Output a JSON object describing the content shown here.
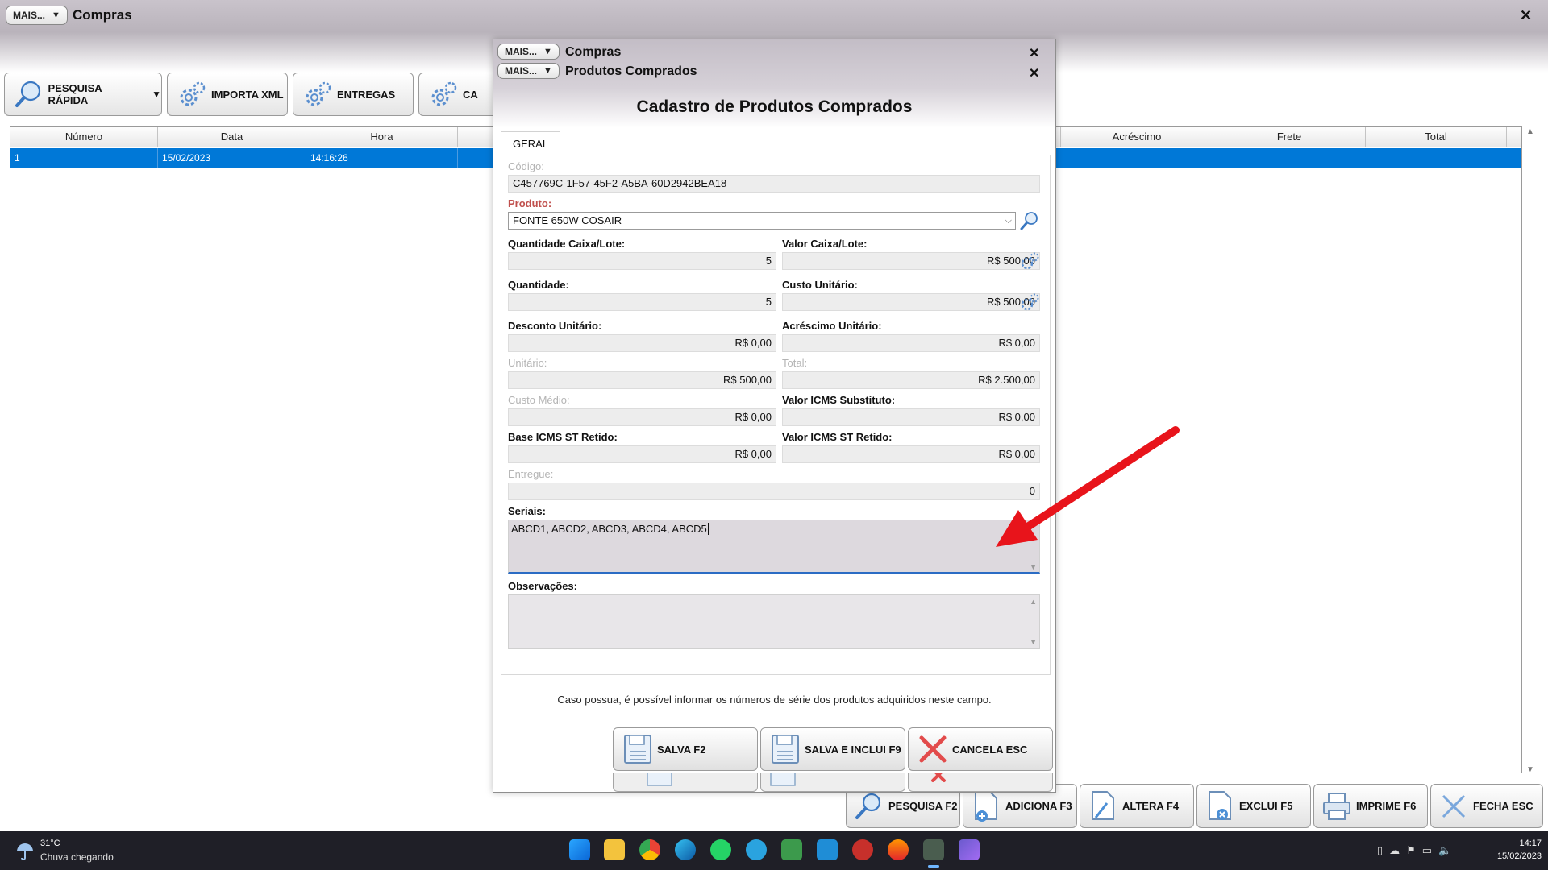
{
  "main": {
    "mais_label": "MAIS...",
    "title": "Compras",
    "toolbar": {
      "pesquisa_rapida": "PESQUISA RÁPIDA",
      "importa_xml": "IMPORTA XML",
      "entregas": "ENTREGAS",
      "fourth_partial": "CA"
    },
    "grid": {
      "columns": [
        "Número",
        "Data",
        "Hora",
        "",
        "",
        "",
        "",
        "Acréscimo",
        "Frete",
        "Total"
      ],
      "rows": [
        {
          "numero": "1",
          "data": "15/02/2023",
          "hora": "14:16:26"
        }
      ]
    },
    "bottom_buttons": {
      "pesquisa": "PESQUISA F2",
      "adiciona": "ADICIONA F3",
      "altera": "ALTERA F4",
      "exclui": "EXCLUI F5",
      "imprime": "IMPRIME F6",
      "fecha": "FECHA ESC"
    }
  },
  "dialog": {
    "bar1": {
      "mais": "MAIS...",
      "title": "Compras"
    },
    "bar2": {
      "mais": "MAIS...",
      "title": "Produtos Comprados"
    },
    "heading": "Cadastro de Produtos Comprados",
    "tab": "GERAL",
    "fields": {
      "codigo_label": "Código:",
      "codigo_value": "C457769C-1F57-45F2-A5BA-60D2942BEA18",
      "produto_label": "Produto:",
      "produto_value": "FONTE 650W COSAIR",
      "qtd_caixa_label": "Quantidade Caixa/Lote:",
      "qtd_caixa_value": "5",
      "valor_caixa_label": "Valor Caixa/Lote:",
      "valor_caixa_value": "R$ 500,00",
      "quantidade_label": "Quantidade:",
      "quantidade_value": "5",
      "custo_unit_label": "Custo Unitário:",
      "custo_unit_value": "R$ 500,00",
      "desconto_label": "Desconto Unitário:",
      "desconto_value": "R$ 0,00",
      "acrescimo_label": "Acréscimo Unitário:",
      "acrescimo_value": "R$ 0,00",
      "unitario_label": "Unitário:",
      "unitario_value": "R$ 500,00",
      "total_label": "Total:",
      "total_value": "R$ 2.500,00",
      "custo_medio_label": "Custo Médio:",
      "custo_medio_value": "R$ 0,00",
      "icms_sub_label": "Valor ICMS Substituto:",
      "icms_sub_value": "R$ 0,00",
      "base_icms_label": "Base ICMS ST Retido:",
      "base_icms_value": "R$ 0,00",
      "valor_icms_label": "Valor ICMS ST Retido:",
      "valor_icms_value": "R$ 0,00",
      "entregue_label": "Entregue:",
      "entregue_value": "0",
      "seriais_label": "Seriais:",
      "seriais_value": "ABCD1, ABCD2, ABCD3, ABCD4, ABCD5",
      "observacoes_label": "Observações:",
      "observacoes_value": ""
    },
    "hint": "Caso possua, é possível informar os números de série dos produtos adquiridos neste campo.",
    "buttons": {
      "salva": "SALVA F2",
      "salva_inclui": "SALVA E INCLUI F9",
      "cancela": "CANCELA ESC"
    }
  },
  "taskbar": {
    "weather_temp": "31°C",
    "weather_text": "Chuva chegando",
    "time": "14:17",
    "date": "15/02/2023"
  },
  "colors": {
    "selection": "#0078d7",
    "required_label": "#c0504d",
    "annotation_arrow": "#e8141b"
  }
}
